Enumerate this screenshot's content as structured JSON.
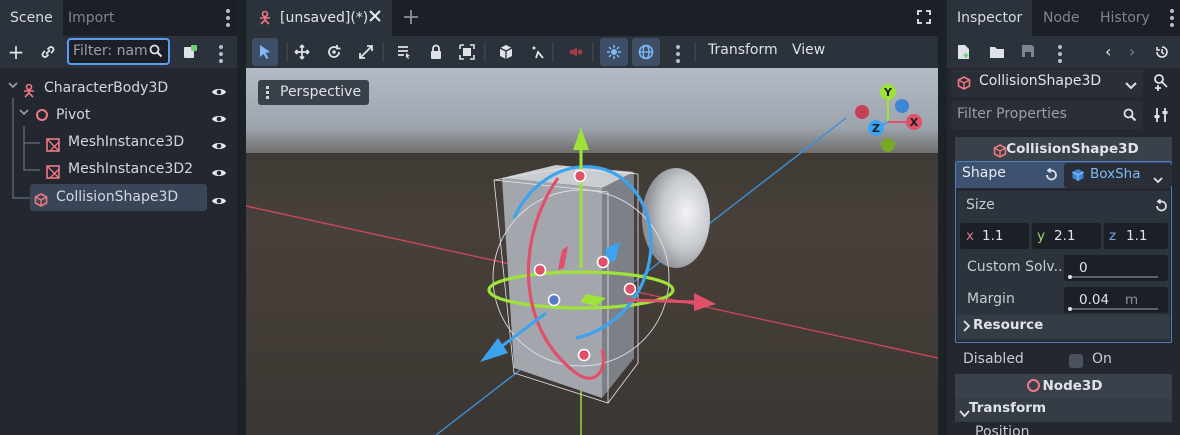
{
  "scene_panel": {
    "tabs": [
      "Scene",
      "Import"
    ],
    "filter_placeholder": "Filter: nam",
    "tree": [
      {
        "label": "CharacterBody3D",
        "icon": "character-body-icon"
      },
      {
        "label": "Pivot",
        "icon": "node3d-icon"
      },
      {
        "label": "MeshInstance3D",
        "icon": "mesh-instance-icon"
      },
      {
        "label": "MeshInstance3D2",
        "icon": "mesh-instance-icon"
      },
      {
        "label": "CollisionShape3D",
        "icon": "collision-shape-icon"
      }
    ]
  },
  "viewport": {
    "tab_label": "[unsaved](*)",
    "menu": [
      "Transform",
      "View"
    ],
    "perspective_label": "Perspective",
    "gizmo_axes": {
      "x": "X",
      "y": "Y",
      "z": "Z"
    }
  },
  "inspector": {
    "tabs": [
      "Inspector",
      "Node",
      "History"
    ],
    "selected_node": "CollisionShape3D",
    "filter_placeholder": "Filter Properties",
    "section_title": "CollisionShape3D",
    "shape_label": "Shape",
    "shape_value": "BoxSha",
    "size_label": "Size",
    "size": {
      "x_label": "x",
      "x": "1.1",
      "y_label": "y",
      "y": "2.1",
      "z_label": "z",
      "z": "1.1"
    },
    "custom_solver_label": "Custom Solv...",
    "custom_solver_value": "0",
    "margin_label": "Margin",
    "margin_value": "0.04",
    "margin_unit": "m",
    "resource_label": "Resource",
    "disabled_label": "Disabled",
    "disabled_value": "On",
    "node3d_section": "Node3D",
    "transform_label": "Transform",
    "position_label": "Position"
  },
  "colors": {
    "accent": "#5b9df1",
    "red": "#e05a6f",
    "green": "#9fe33a",
    "blue": "#3ca3ef"
  }
}
